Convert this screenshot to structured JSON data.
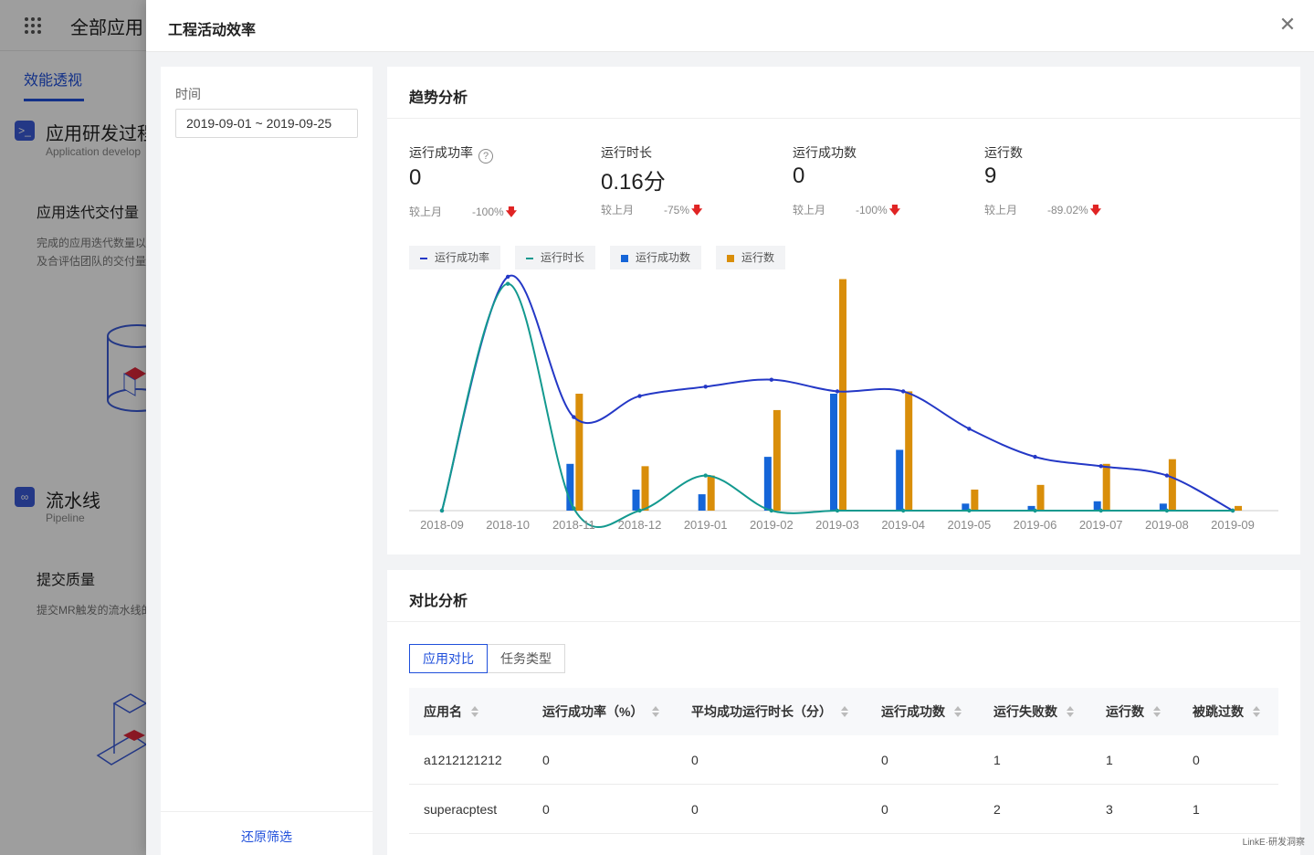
{
  "background": {
    "app_title": "全部应用",
    "tab": "效能透视",
    "section1": {
      "title": "应用研发过程",
      "subtitle": "Application develop"
    },
    "card1": {
      "title": "应用迭代交付量",
      "desc": "完成的应用迭代数量以及合评估团队的交付量"
    },
    "section2": {
      "title": "流水线",
      "subtitle": "Pipeline"
    },
    "card2": {
      "title": "提交质量",
      "desc": "提交MR触发的流水线的"
    }
  },
  "drawer": {
    "title": "工程活动效率",
    "filter": {
      "time_label": "时间",
      "date_range": "2019-09-01 ~ 2019-09-25",
      "reset": "还原筛选"
    },
    "trend": {
      "title": "趋势分析",
      "metrics": [
        {
          "label": "运行成功率",
          "value": "0",
          "compare_label": "较上月",
          "compare_value": "-100%",
          "has_help": true
        },
        {
          "label": "运行时长",
          "value": "0.16分",
          "compare_label": "较上月",
          "compare_value": "-75%"
        },
        {
          "label": "运行成功数",
          "value": "0",
          "compare_label": "较上月",
          "compare_value": "-100%"
        },
        {
          "label": "运行数",
          "value": "9",
          "compare_label": "较上月",
          "compare_value": "-89.02%"
        }
      ]
    },
    "compare": {
      "title": "对比分析",
      "segments": [
        "应用对比",
        "任务类型"
      ],
      "columns": [
        "应用名",
        "运行成功率（%）",
        "平均成功运行时长（分）",
        "运行成功数",
        "运行失败数",
        "运行数",
        "被跳过数"
      ],
      "rows": [
        [
          "a1212121212",
          "0",
          "0",
          "0",
          "1",
          "1",
          "0"
        ],
        [
          "superacptest",
          "0",
          "0",
          "0",
          "2",
          "3",
          "1"
        ]
      ]
    }
  },
  "chart_data": {
    "type": "line",
    "categories": [
      "2018-09",
      "2018-10",
      "2018-11",
      "2018-12",
      "2019-01",
      "2019-02",
      "2019-03",
      "2019-04",
      "2019-05",
      "2019-06",
      "2019-07",
      "2019-08",
      "2019-09"
    ],
    "series": [
      {
        "name": "运行成功率",
        "kind": "line",
        "color": "#2438c6",
        "values": [
          0,
          100,
          40,
          49,
          53,
          56,
          51,
          51,
          35,
          23,
          19,
          15,
          0
        ]
      },
      {
        "name": "运行时长",
        "kind": "line",
        "color": "#13998f",
        "values": [
          0,
          97,
          1,
          0,
          15,
          0,
          0,
          0,
          0,
          0,
          0,
          0,
          0
        ]
      },
      {
        "name": "运行成功数",
        "kind": "bar",
        "color": "#1565d8",
        "values": [
          0,
          0,
          20,
          9,
          7,
          23,
          50,
          26,
          3,
          2,
          4,
          3,
          0
        ]
      },
      {
        "name": "运行数",
        "kind": "bar",
        "color": "#d98e0a",
        "values": [
          0,
          0,
          50,
          19,
          15,
          43,
          99,
          51,
          9,
          11,
          20,
          22,
          2
        ]
      }
    ],
    "grid": false,
    "legend_position": "top-left"
  },
  "watermark": "LinkE·研发洞察"
}
